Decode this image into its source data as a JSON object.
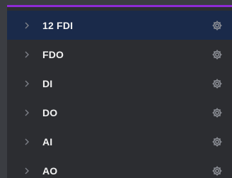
{
  "tree": {
    "items": [
      {
        "label": "12 FDI",
        "selected": true
      },
      {
        "label": "FDO",
        "selected": false
      },
      {
        "label": "DI",
        "selected": false
      },
      {
        "label": "DO",
        "selected": false
      },
      {
        "label": "AI",
        "selected": false
      },
      {
        "label": "AO",
        "selected": false
      }
    ]
  },
  "colors": {
    "accent_bar": "#8e2bd4",
    "selected_row": "#1a2a4a",
    "panel_bg": "#2c2d31"
  },
  "icons": {
    "expand": "chevron-right-icon",
    "settings": "gear-icon"
  }
}
